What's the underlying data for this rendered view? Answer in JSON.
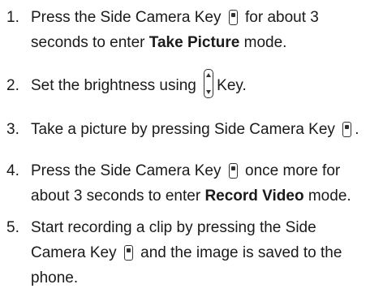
{
  "steps": [
    {
      "number": "1.",
      "line1_a": "Press the Side Camera Key",
      "line1_b": "for about 3",
      "line2_a": "seconds to enter",
      "line2_bold": "Take Picture",
      "line2_b": "mode.",
      "key_icon": "side-camera-key-icon"
    },
    {
      "number": "2.",
      "text_a": "Set the brightness using",
      "text_b": "Key.",
      "key_icon": "volume-key-icon"
    },
    {
      "number": "3.",
      "text_a": "Take a picture by pressing Side Camera Key",
      "text_b": ".",
      "key_icon": "side-camera-key-icon"
    },
    {
      "number": "4.",
      "line1_a": "Press the Side Camera Key",
      "line1_b": "once more for",
      "line2_a": "about 3 seconds to enter",
      "line2_bold": "Record Video",
      "line2_b": "mode.",
      "key_icon": "side-camera-key-icon"
    },
    {
      "number": "5.",
      "line1": "Start recording a clip by pressing the Side",
      "line2_a": "Camera Key",
      "line2_b": "and the image is saved to the",
      "line3": "phone.",
      "key_icon": "side-camera-key-icon"
    }
  ]
}
